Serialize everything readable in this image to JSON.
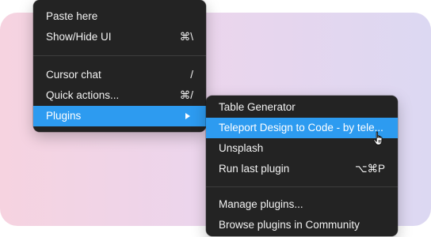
{
  "main_menu": {
    "items": [
      {
        "label": "Paste here",
        "shortcut": ""
      },
      {
        "label": "Show/Hide UI",
        "shortcut": "⌘\\"
      },
      {
        "label": "Cursor chat",
        "shortcut": "/"
      },
      {
        "label": "Quick actions...",
        "shortcut": "⌘/"
      },
      {
        "label": "Plugins",
        "shortcut": ""
      }
    ]
  },
  "plugins_submenu": {
    "items": [
      {
        "label": "Table Generator",
        "shortcut": ""
      },
      {
        "label": "Teleport Design to Code - by tele...",
        "shortcut": ""
      },
      {
        "label": "Unsplash",
        "shortcut": ""
      },
      {
        "label": "Run last plugin",
        "shortcut": "⌥⌘P"
      },
      {
        "label": "Manage plugins...",
        "shortcut": ""
      },
      {
        "label": "Browse plugins in Community",
        "shortcut": ""
      }
    ]
  },
  "colors": {
    "menu_background": "#232323",
    "highlight": "#2d9bf0",
    "text": "#f2f2f2"
  },
  "icons": {
    "submenu_arrow": "triangle-right-icon",
    "cursor": "hand-pointer-icon"
  }
}
